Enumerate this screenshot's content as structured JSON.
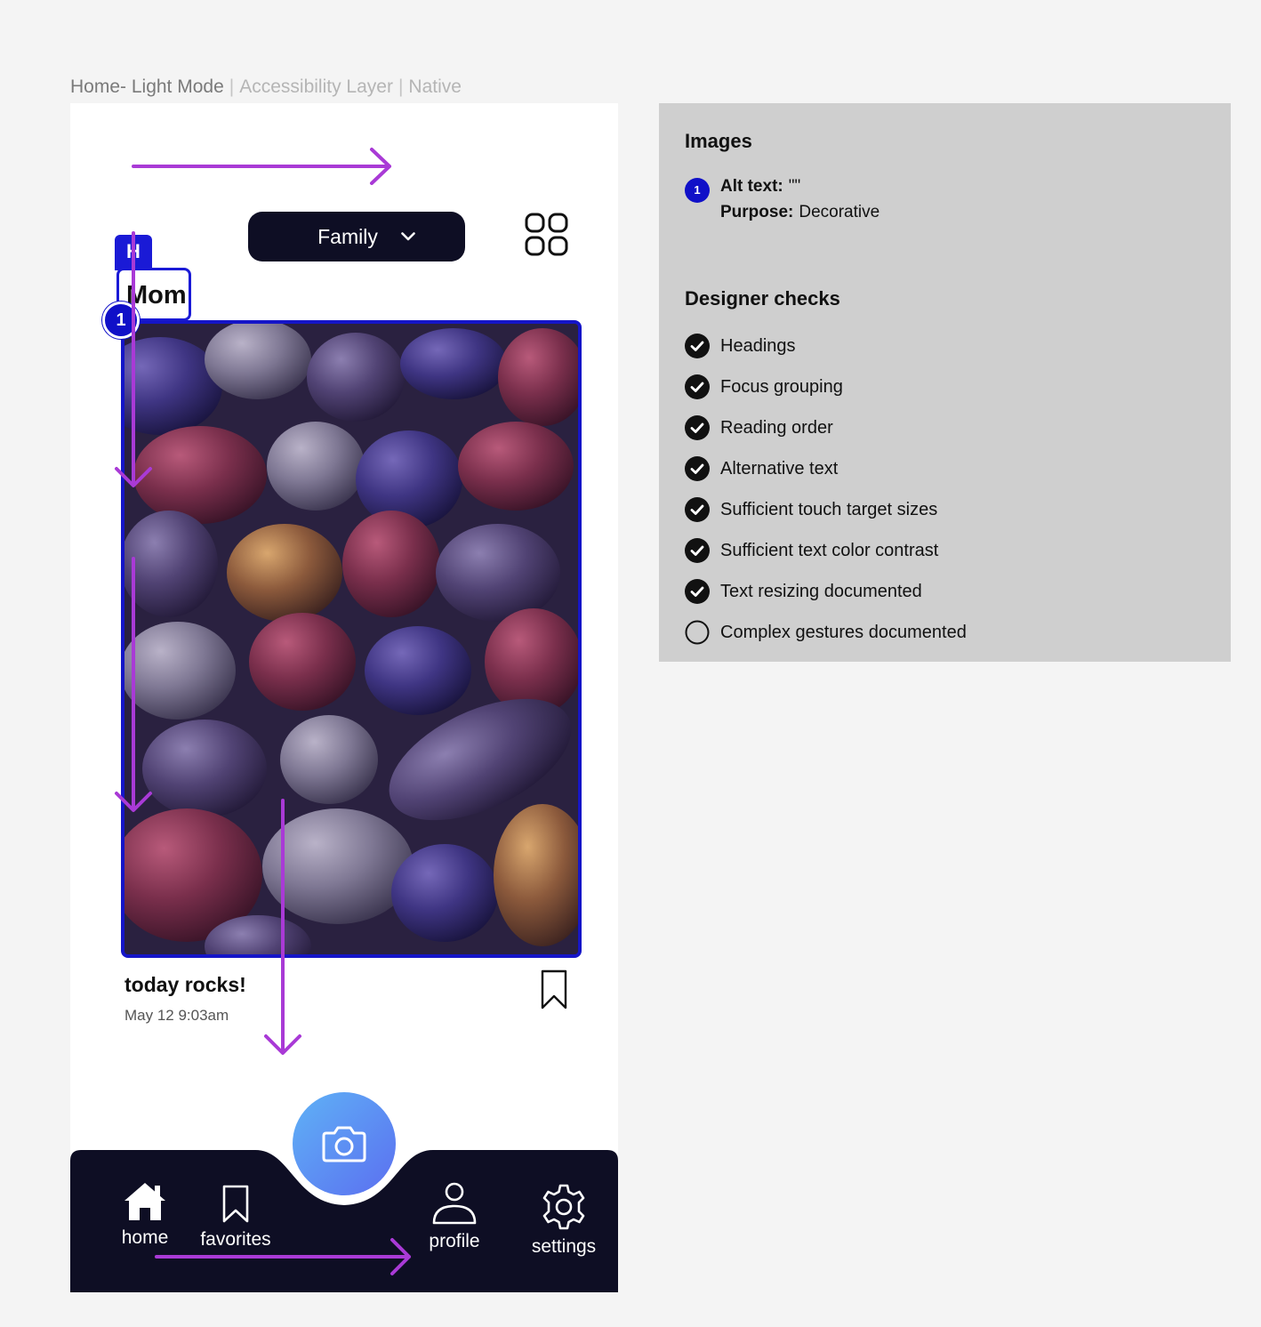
{
  "frame": {
    "title": "Home- Light Mode",
    "layer": "Accessibility Layer",
    "platform": "Native",
    "separator": "|"
  },
  "app": {
    "family_selector": {
      "label": "Family",
      "icon": "chevron-down-icon"
    },
    "grid_icon": "grid-icon",
    "heading_badge": "H",
    "heading_text": "Mom",
    "image_marker": "1",
    "post": {
      "title": "today rocks!",
      "date": "May 12 9:03am",
      "bookmark_icon": "bookmark-icon"
    },
    "camera_icon": "camera-icon",
    "nav": [
      {
        "label": "home",
        "icon": "home-icon"
      },
      {
        "label": "favorites",
        "icon": "bookmark-icon"
      },
      {
        "label": "profile",
        "icon": "user-icon"
      },
      {
        "label": "settings",
        "icon": "gear-icon"
      }
    ]
  },
  "panel": {
    "images_title": "Images",
    "image_entries": [
      {
        "number": "1",
        "alt_label": "Alt text:",
        "alt_value": "\"\"",
        "purpose_label": "Purpose:",
        "purpose_value": "Decorative"
      }
    ],
    "checks_title": "Designer checks",
    "checks": [
      {
        "label": "Headings",
        "done": true
      },
      {
        "label": "Focus grouping",
        "done": true
      },
      {
        "label": "Reading order",
        "done": true
      },
      {
        "label": "Alternative text",
        "done": true
      },
      {
        "label": "Sufficient touch target sizes",
        "done": true
      },
      {
        "label": "Sufficient text color contrast",
        "done": true
      },
      {
        "label": "Text resizing documented",
        "done": true
      },
      {
        "label": "Complex gestures documented",
        "done": false
      }
    ]
  },
  "colors": {
    "annotation_arrow": "#a93ad6",
    "focus_blue": "#1515c8",
    "nav_dark": "#0e0e24",
    "panel_bg": "#cfcfcf"
  }
}
